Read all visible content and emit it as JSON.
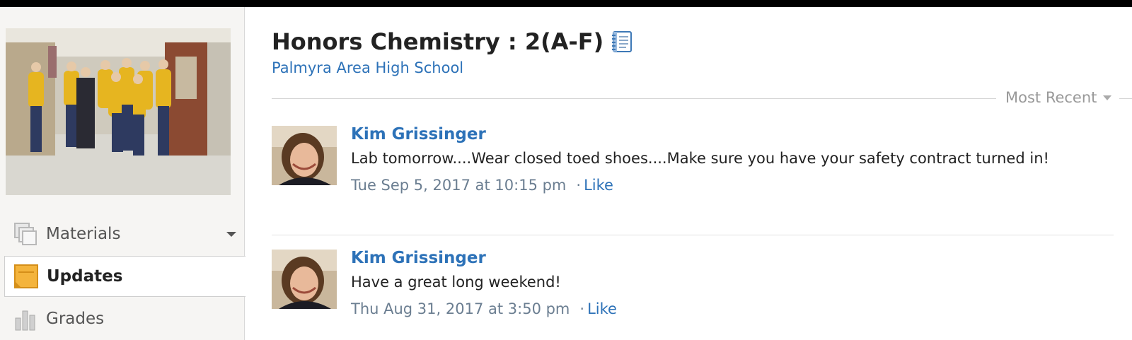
{
  "sidebar": {
    "photo_alt": "Course profile photo",
    "nav": [
      {
        "label": "Materials",
        "icon": "materials-icon"
      },
      {
        "label": "Updates",
        "icon": "updates-icon"
      },
      {
        "label": "Grades",
        "icon": "grades-icon"
      }
    ]
  },
  "header": {
    "title": "Honors Chemistry : 2(A-F)",
    "school": "Palmyra Area High School"
  },
  "sort": {
    "label": "Most Recent"
  },
  "posts": [
    {
      "author": "Kim Grissinger",
      "message": "Lab tomorrow....Wear closed toed shoes....Make sure you have your safety contract turned in!",
      "timestamp": "Tue Sep 5, 2017 at 10:15 pm",
      "like_label": "Like"
    },
    {
      "author": "Kim Grissinger",
      "message": "Have a great long weekend!",
      "timestamp": "Thu Aug 31, 2017 at 3:50 pm",
      "like_label": "Like"
    }
  ],
  "colors": {
    "link": "#2d72b8",
    "updates_icon": "#f4b43c",
    "sidebar_bg": "#f6f5f3"
  }
}
